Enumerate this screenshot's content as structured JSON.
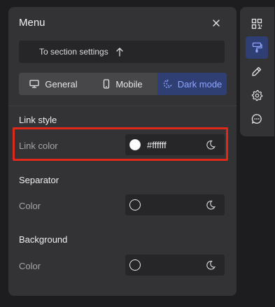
{
  "menu": {
    "title": "Menu",
    "section_link": "To section settings",
    "tabs": [
      {
        "label": "General",
        "icon": "monitor-icon",
        "active": false
      },
      {
        "label": "Mobile",
        "icon": "phone-icon",
        "active": false
      },
      {
        "label": "Dark mode",
        "icon": "dark-mode-icon",
        "active": true
      }
    ],
    "sections": [
      {
        "title": "Link style",
        "label": "Link color",
        "value": "#ffffff",
        "swatch": "#ffffff"
      },
      {
        "title": "Separator",
        "label": "Color",
        "value": "",
        "swatch": ""
      },
      {
        "title": "Background",
        "label": "Color",
        "value": "",
        "swatch": ""
      }
    ]
  },
  "toolbar": {
    "items": [
      "qr-code-icon",
      "paint-roller-icon",
      "pencil-icon",
      "gear-icon",
      "chat-icon"
    ],
    "active": "paint-roller-icon"
  },
  "colors": {
    "accent": "#8ea6ff",
    "active_bg": "#2f3e73",
    "highlight": "#e0291a",
    "panel": "#333335"
  }
}
